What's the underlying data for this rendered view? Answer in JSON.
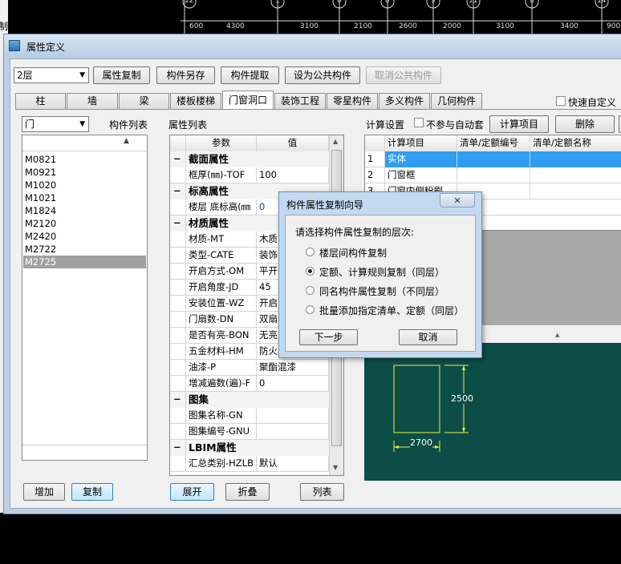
{
  "cad": {
    "axis_numbers": [
      "12",
      "1",
      "0",
      "0",
      "9",
      "11",
      "",
      "8",
      "14"
    ],
    "dimensions": [
      "600",
      "4300",
      "3100",
      "2100",
      "2600",
      "2000",
      "3100",
      "3400",
      "900"
    ],
    "left_strip_text": "制",
    "drawing": {
      "width_label": "2700",
      "height_label": "2500"
    }
  },
  "window": {
    "title": "属性定义"
  },
  "toolbar": {
    "floor_value": "2层",
    "buttons": [
      "属性复制",
      "构件另存",
      "构件提取",
      "设为公共构件"
    ],
    "disabled_button": "取消公共构件"
  },
  "tabs": [
    "柱",
    "墙",
    "梁",
    "楼板楼梯",
    "门窗洞口",
    "装饰工程",
    "零星构件",
    "多义构件",
    "几何构件"
  ],
  "active_tab": "门窗洞口",
  "quick_custom": "快速自定义",
  "component_panel": {
    "type_value": "门",
    "title": "构件列表",
    "items": [
      "M0821",
      "M0921",
      "M1020",
      "M1021",
      "M1824",
      "M2120",
      "M2420",
      "M2722",
      "M2725"
    ],
    "selected": "M2725",
    "add_label": "增加",
    "copy_label": "复制"
  },
  "property_panel": {
    "title": "属性列表",
    "col_param": "参数",
    "col_value": "值",
    "rows": [
      {
        "group": true,
        "label": "截面属性"
      },
      {
        "label": "框厚(㎜)-TOF",
        "value": "100"
      },
      {
        "group": true,
        "label": "标高属性"
      },
      {
        "label": "楼层 底标高(㎜",
        "value": "0",
        "blue": true
      },
      {
        "group": true,
        "label": "材质属性"
      },
      {
        "label": "材质-MT",
        "value": "木质"
      },
      {
        "label": "类型-CATE",
        "value": "装饰"
      },
      {
        "label": "开启方式-OM",
        "value": "平开"
      },
      {
        "label": "开启角度-JD",
        "value": "45"
      },
      {
        "label": "安装位置-WZ",
        "value": "开启"
      },
      {
        "label": "门扇数-DN",
        "value": "双扇"
      },
      {
        "label": "是否有亮-BON",
        "value": "无亮"
      },
      {
        "label": "五金材料-HM",
        "value": "防火"
      },
      {
        "label": "油漆-P",
        "value": "聚酯混漆"
      },
      {
        "label": "增减遍数(遍)-F",
        "value": "0"
      },
      {
        "group": true,
        "label": "图集"
      },
      {
        "label": "图集名称-GN",
        "value": ""
      },
      {
        "label": "图集编号-GNU",
        "value": ""
      },
      {
        "group": true,
        "label": "LBIM属性"
      },
      {
        "label": "汇总类别-HZLB",
        "value": "默认"
      }
    ],
    "expand_label": "展开",
    "collapse_label": "折叠",
    "list_label": "列表"
  },
  "calc_panel": {
    "title": "计算设置",
    "no_auto_label": "不参与自动套",
    "calc_items_btn": "计算项目",
    "delete_btn": "删除",
    "col_item": "计算项目",
    "col_code": "清单/定额编号",
    "col_name": "清单/定额名称",
    "rows": [
      {
        "no": "1",
        "item": "实体"
      },
      {
        "no": "2",
        "item": "门窗框"
      },
      {
        "no": "3",
        "item": "门窗内侧粉刷"
      }
    ]
  },
  "dialog": {
    "title": "构件属性复制向导",
    "prompt": "请选择构件属性复制的层次:",
    "options": [
      "楼层间构件复制",
      "定额、计算规则复制（同层）",
      "同名构件属性复制（不同层）",
      "批量添加指定清单、定额（同层）"
    ],
    "selected_option": "定额、计算规则复制（同层）",
    "next_label": "下一步",
    "cancel_label": "取消"
  },
  "colors": {
    "drawing_bg": "#0d4d47",
    "drawing_line": "#e5f23a",
    "selection": "#2f9df0"
  }
}
